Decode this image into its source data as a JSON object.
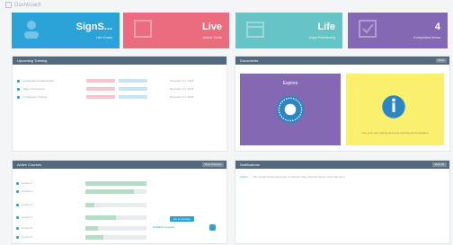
{
  "header": {
    "title": "Dashboard"
  },
  "stats": [
    {
      "value": "SignS...",
      "label": "Life Goals",
      "color": "#2ca3d8",
      "icon": "user-icon"
    },
    {
      "value": "Live",
      "label": "Active Certs",
      "color": "#eb6b7f",
      "icon": "certificate-icon"
    },
    {
      "value": "Life",
      "label": "Days Remaining",
      "color": "#67c4c6",
      "icon": "calendar-icon"
    },
    {
      "value": "4",
      "label": "Completed Items",
      "color": "#8568b4",
      "icon": "check-icon"
    }
  ],
  "upcoming": {
    "title": "Upcoming Training",
    "action": "",
    "items": [
      {
        "name": "Leadership Fundamentals",
        "date": "December 31, 2015"
      },
      {
        "name": "Safety Procedures",
        "date": "December 31, 2015"
      },
      {
        "name": "Compliance Training",
        "date": "December 31, 2015"
      }
    ]
  },
  "documents": {
    "title": "Documents",
    "action": "View",
    "expire_title": "Expires",
    "guide_text": "Use your user training and your learning documentation"
  },
  "active": {
    "title": "Active Courses",
    "action": "View Courses",
    "items": [
      {
        "name": "Course 1",
        "progress": 1.0
      },
      {
        "name": "Course 2",
        "progress": 0.8
      },
      {
        "name": "Course 3",
        "progress": 0.15
      },
      {
        "name": "Course 4",
        "progress": 0.5
      },
      {
        "name": "Course 5",
        "progress": 0.2
      },
      {
        "name": "Course 6",
        "progress": 0.3
      }
    ],
    "cta": "Go to courses",
    "cta2": "Available Courses"
  },
  "notifications": {
    "title": "Notifications",
    "action": "View All",
    "items": [
      {
        "from": "Admin",
        "text": "The assignments have been completed. Stay Training happy, there has been..."
      }
    ]
  }
}
